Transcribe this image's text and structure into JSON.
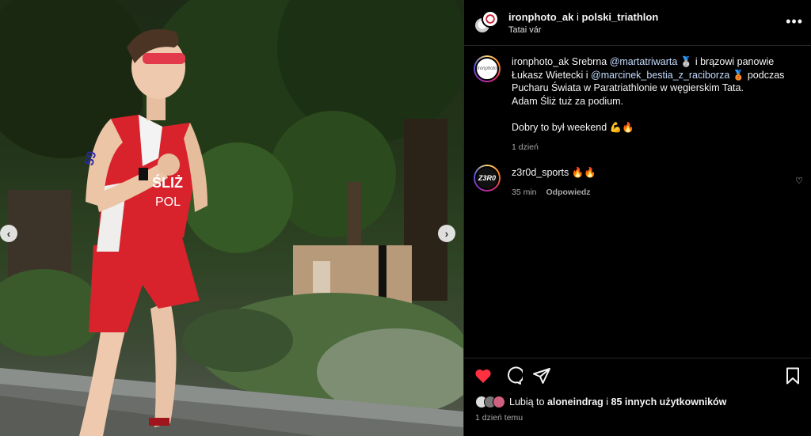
{
  "photo": {
    "jersey_name": "ŚLIŻ",
    "jersey_country": "POL",
    "arm_number": "59"
  },
  "header": {
    "title_user": "ironphoto_ak",
    "title_sep": " i ",
    "title_collab": "polski_triathlon",
    "location": "Tatai vár"
  },
  "caption": {
    "user": "ironphoto_ak",
    "t1": " Srebrna ",
    "m1": "@martatriwarta",
    "e1": " 🥈",
    "t2": " i brązowi panowie Łukasz Wietecki i ",
    "m2": "@marcinek_bestia_z_raciborza",
    "e2": " 🥉",
    "t3": " podczas Pucharu Świata w Paratriathlonie w węgierskim Tata.",
    "line2": "Adam Śliż tuż za podium.",
    "para2": "Dobry to był weekend 💪🔥",
    "time": "1 dzień"
  },
  "comment": {
    "avatar_text": "Z3R0",
    "user": "z3r0d_sports",
    "text": " 🔥🔥",
    "time": "35 min",
    "reply": "Odpowiedz"
  },
  "likes": {
    "prefix": "Lubią to ",
    "user": "aloneindrag",
    "mid": " i ",
    "others": "85 innych użytkowników"
  },
  "post_time": "1 dzień temu",
  "colors": {
    "like_red": "#ff3040",
    "mention": "#c5dcff",
    "meta_gray": "#a8a8a8"
  }
}
